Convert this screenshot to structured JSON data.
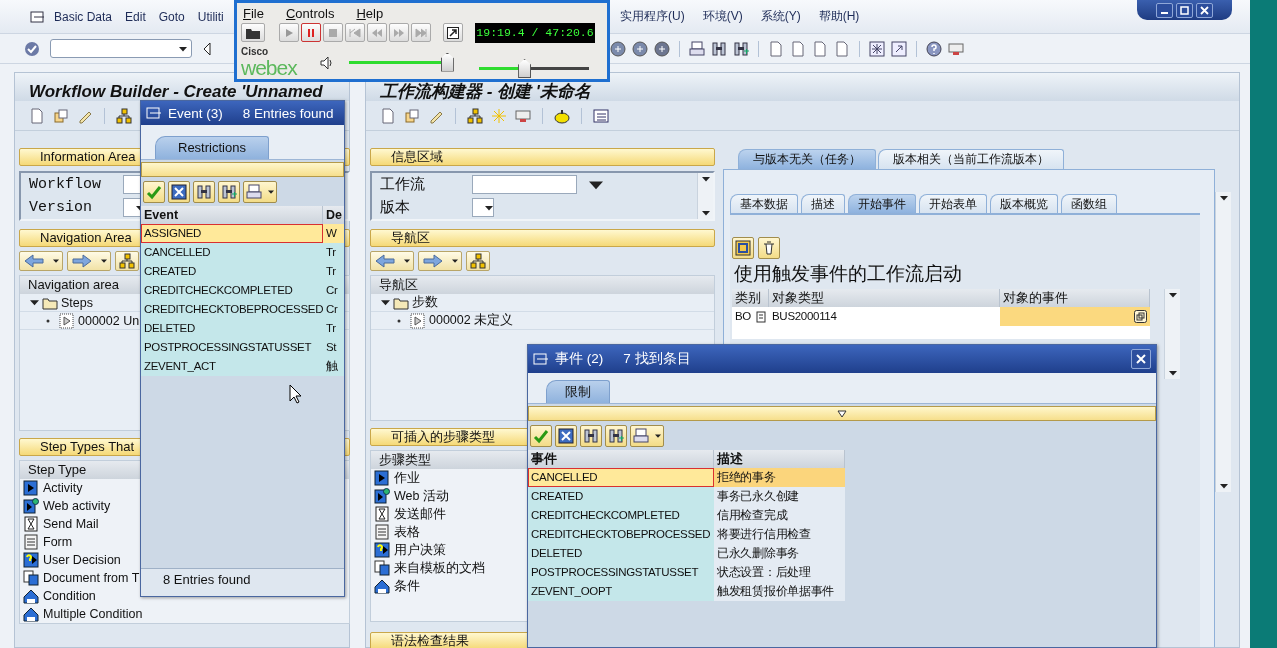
{
  "menu_left": [
    {
      "label": "Basic Data"
    },
    {
      "label": "Edit"
    },
    {
      "label": "Goto"
    },
    {
      "label": "Utiliti"
    }
  ],
  "menu_right": [
    {
      "label": "实用程序(U)"
    },
    {
      "label": "环境(V)"
    },
    {
      "label": "系统(Y)"
    },
    {
      "label": "帮助(H)"
    }
  ],
  "webex": {
    "menu": [
      "File",
      "Controls",
      "Help"
    ],
    "time": "19:19.4 / 47:20.6",
    "logo_top": "Cisco",
    "logo_main": "webex",
    "volume": {
      "level": 0.95
    },
    "position": {
      "level": 0.41
    }
  },
  "left_window": {
    "title": "Workflow Builder - Create 'Unnamed",
    "info_area": {
      "title": "Information Area",
      "fields": [
        {
          "label": "Workflow",
          "kind": "text"
        },
        {
          "label": "Version",
          "kind": "dropdown"
        }
      ]
    },
    "navigation": {
      "title": "Navigation Area",
      "header": "Navigation area",
      "tree": [
        {
          "label": "Steps",
          "expanded": true,
          "children": [
            {
              "label": "000002 Un"
            }
          ]
        }
      ]
    },
    "step_types": {
      "title": "Step Types That",
      "header": "Step Type",
      "items": [
        {
          "label": "Activity",
          "kind": "activity"
        },
        {
          "label": "Web activity",
          "kind": "web"
        },
        {
          "label": "Send Mail",
          "kind": "mail"
        },
        {
          "label": "Form",
          "kind": "form"
        },
        {
          "label": "User Decision",
          "kind": "decision"
        },
        {
          "label": "Document from T",
          "kind": "document"
        },
        {
          "label": "Condition",
          "kind": "condition"
        },
        {
          "label": "Multiple Condition",
          "kind": "condition"
        }
      ]
    }
  },
  "right_window": {
    "title": "工作流构建器 - 创建 '未命名",
    "info_area": {
      "title": "信息区域",
      "fields": [
        {
          "label": "工作流",
          "kind": "text"
        },
        {
          "label": "版本",
          "kind": "dropdown"
        }
      ]
    },
    "navigation": {
      "title": "导航区",
      "header": "导航区",
      "tree": [
        {
          "label": "步数",
          "expanded": true,
          "children": [
            {
              "label": "000002 未定义"
            }
          ]
        }
      ]
    },
    "step_types": {
      "title": "可插入的步骤类型",
      "header": "步骤类型",
      "items": [
        {
          "label": "作业",
          "kind": "activity"
        },
        {
          "label": "Web 活动",
          "kind": "web"
        },
        {
          "label": "发送邮件",
          "kind": "mail"
        },
        {
          "label": "表格",
          "kind": "form"
        },
        {
          "label": "用户决策",
          "kind": "decision"
        },
        {
          "label": "来自模板的文档",
          "kind": "document"
        },
        {
          "label": "条件",
          "kind": "condition"
        }
      ]
    },
    "check_results": {
      "title": "语法检查结果"
    },
    "tabs": [
      {
        "label": "与版本无关（任务）",
        "selected": true
      },
      {
        "label": "版本相关（当前工作流版本）",
        "selected": false
      }
    ],
    "subtabs": [
      {
        "label": "基本数据",
        "selected": false
      },
      {
        "label": "描述",
        "selected": false
      },
      {
        "label": "开始事件",
        "selected": true
      },
      {
        "label": "开始表单",
        "selected": false
      },
      {
        "label": "版本概览",
        "selected": false
      },
      {
        "label": "函数组",
        "selected": false
      }
    ],
    "heading": "使用触发事件的工作流启动",
    "table": {
      "columns": [
        "类别",
        "对象类型",
        "对象的事件"
      ],
      "rows": [
        {
          "category": "BO",
          "object_type": "BUS2000114",
          "event_focused": true
        }
      ]
    }
  },
  "event_popup": {
    "title": "Event (3)",
    "count": "8 Entries found",
    "tab": "Restrictions",
    "columns": [
      "Event",
      "De"
    ],
    "rows": [
      {
        "event": "ASSIGNED",
        "description": "W",
        "selected": true
      },
      {
        "event": "CANCELLED",
        "description": "Tr",
        "selected": false
      },
      {
        "event": "CREATED",
        "description": "Tr",
        "selected": false
      },
      {
        "event": "CREDITCHECKCOMPLETED",
        "description": "Cr",
        "selected": false
      },
      {
        "event": "CREDITCHECKTOBEPROCESSED",
        "description": "Cr",
        "selected": false
      },
      {
        "event": "DELETED",
        "description": "Tr",
        "selected": false
      },
      {
        "event": "POSTPROCESSINGSTATUSSET",
        "description": "St",
        "selected": false
      },
      {
        "event": "ZEVENT_ACT",
        "description": "触",
        "selected": false
      }
    ],
    "footer": "8 Entries found"
  },
  "event_popup_cn": {
    "title": "事件 (2)",
    "count": "7 找到条目",
    "tab": "限制",
    "columns": [
      "事件",
      "描述"
    ],
    "rows": [
      {
        "event": "CANCELLED",
        "description": "拒绝的事务",
        "selected": true
      },
      {
        "event": "CREATED",
        "description": "事务已永久创建",
        "selected": false
      },
      {
        "event": "CREDITCHECKCOMPLETED",
        "description": "信用检查完成",
        "selected": false
      },
      {
        "event": "CREDITCHECKTOBEPROCESSED",
        "description": "将要进行信用检查",
        "selected": false
      },
      {
        "event": "DELETED",
        "description": "已永久删除事务",
        "selected": false
      },
      {
        "event": "POSTPROCESSINGSTATUSSET",
        "description": "状态设置：后处理",
        "selected": false
      },
      {
        "event": "ZEVENT_OOPT",
        "description": "触发租赁报价单据事件",
        "selected": false
      }
    ]
  }
}
